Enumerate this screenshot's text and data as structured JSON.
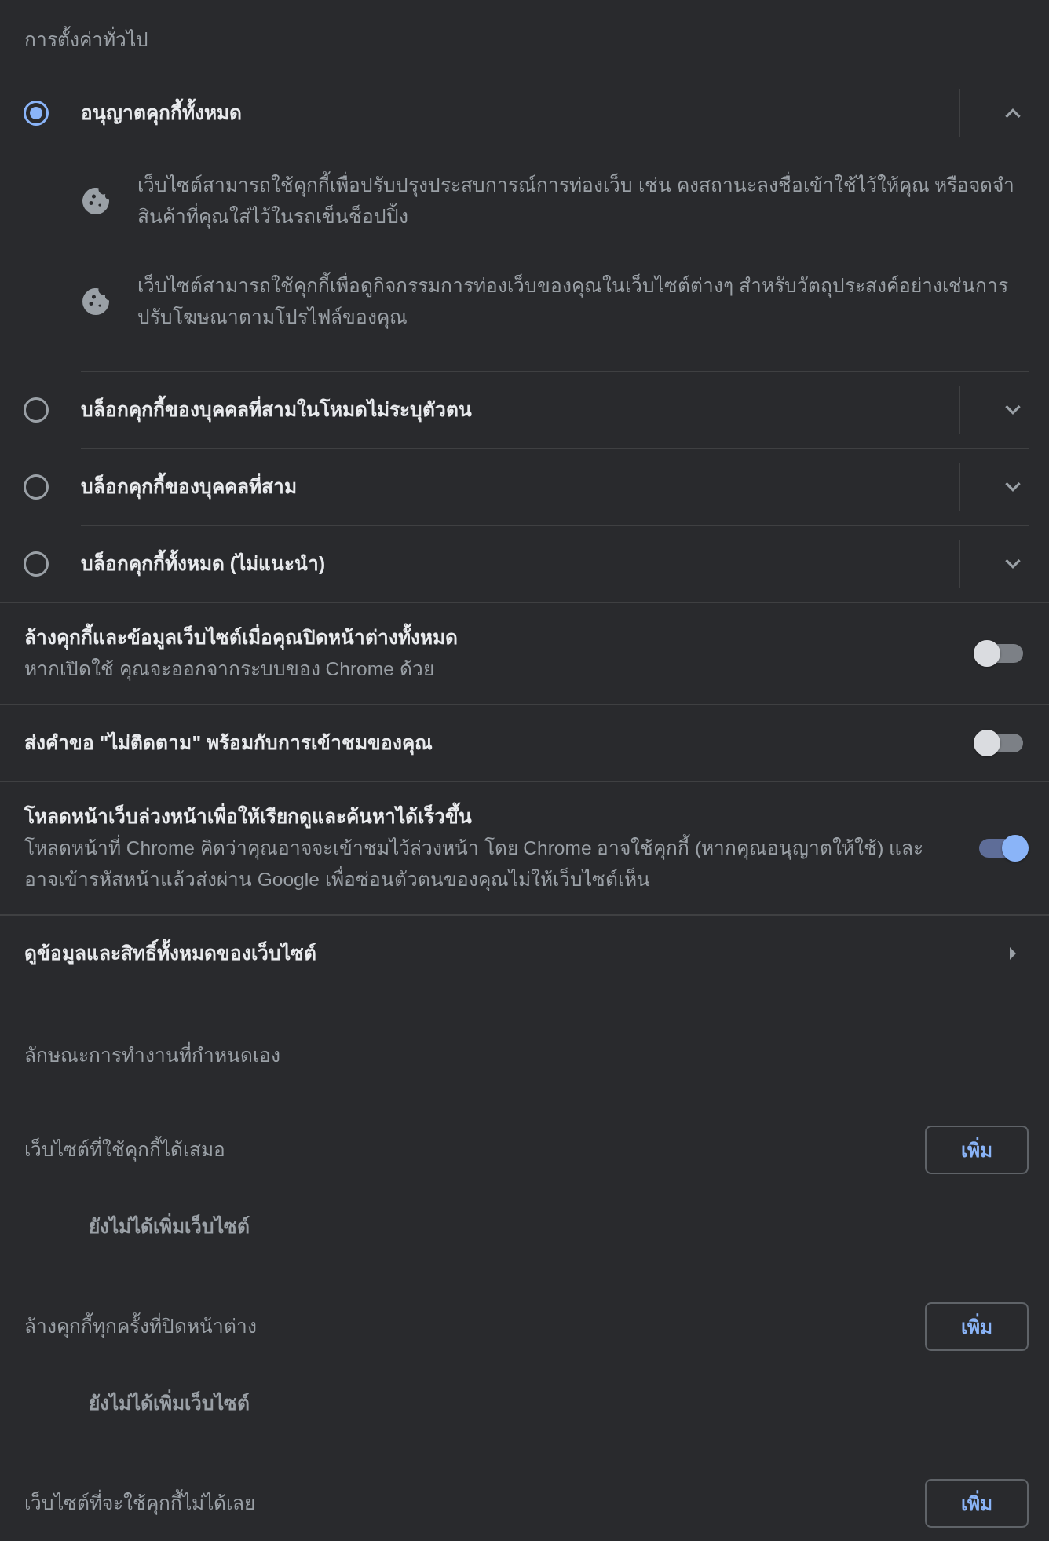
{
  "general": {
    "heading": "การตั้งค่าทั่วไป",
    "options": [
      {
        "label": "อนุญาตคุกกี้ทั้งหมด",
        "selected": true,
        "expanded": true,
        "details": [
          "เว็บไซต์สามารถใช้คุกกี้เพื่อปรับปรุงประสบการณ์การท่องเว็บ เช่น คงสถานะลงชื่อเข้าใช้ไว้ให้คุณ หรือจดจำสินค้าที่คุณใส่ไว้ในรถเข็นช็อปปิ้ง",
          "เว็บไซต์สามารถใช้คุกกี้เพื่อดูกิจกรรมการท่องเว็บของคุณในเว็บไซต์ต่างๆ สำหรับวัตถุประสงค์อย่างเช่นการปรับโฆษณาตามโปรไฟล์ของคุณ"
        ]
      },
      {
        "label": "บล็อกคุกกี้ของบุคคลที่สามในโหมดไม่ระบุตัวตน",
        "selected": false,
        "expanded": false
      },
      {
        "label": "บล็อกคุกกี้ของบุคคลที่สาม",
        "selected": false,
        "expanded": false
      },
      {
        "label": "บล็อกคุกกี้ทั้งหมด (ไม่แนะนำ)",
        "selected": false,
        "expanded": false
      }
    ]
  },
  "toggles": [
    {
      "title": "ล้างคุกกี้และข้อมูลเว็บไซต์เมื่อคุณปิดหน้าต่างทั้งหมด",
      "description": "หากเปิดใช้ คุณจะออกจากระบบของ Chrome ด้วย",
      "on": false
    },
    {
      "title": "ส่งคำขอ \"ไม่ติดตาม\" พร้อมกับการเข้าชมของคุณ",
      "on": false
    },
    {
      "title": "โหลดหน้าเว็บล่วงหน้าเพื่อให้เรียกดูและค้นหาได้เร็วขึ้น",
      "description": "โหลดหน้าที่ Chrome คิดว่าคุณอาจจะเข้าชมไว้ล่วงหน้า โดย Chrome อาจใช้คุกกี้ (หากคุณอนุญาตให้ใช้) และอาจเข้ารหัสหน้าแล้วส่งผ่าน Google เพื่อซ่อนตัวตนของคุณไม่ให้เว็บไซต์เห็น",
      "on": true
    }
  ],
  "site_data_link": {
    "label": "ดูข้อมูลและสิทธิ์ทั้งหมดของเว็บไซต์"
  },
  "custom_behaviors": {
    "heading": "ลักษณะการทำงานที่กำหนดเอง",
    "lists": [
      {
        "title": "เว็บไซต์ที่ใช้คุกกี้ได้เสมอ",
        "button": "เพิ่ม",
        "empty_message": "ยังไม่ได้เพิ่มเว็บไซต์"
      },
      {
        "title": "ล้างคุกกี้ทุกครั้งที่ปิดหน้าต่าง",
        "button": "เพิ่ม",
        "empty_message": "ยังไม่ได้เพิ่มเว็บไซต์"
      },
      {
        "title": "เว็บไซต์ที่จะใช้คุกกี้ไม่ได้เลย",
        "button": "เพิ่ม"
      }
    ]
  }
}
